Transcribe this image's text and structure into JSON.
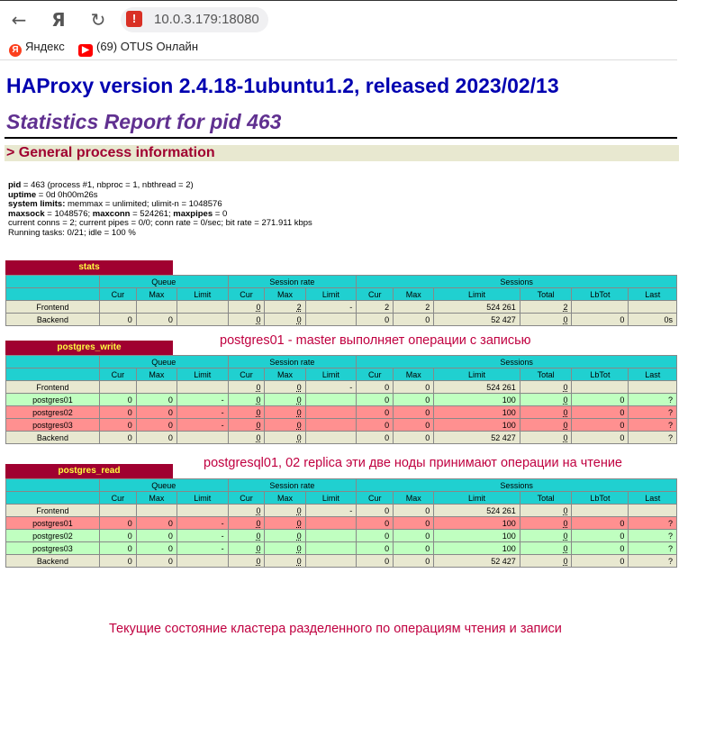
{
  "browser": {
    "url": "10.0.3.179:18080",
    "bookmarks": [
      "Яндекс",
      "(69) OTUS Онлайн"
    ]
  },
  "page": {
    "title": "HAProxy version 2.4.18-1ubuntu1.2, released 2023/02/13",
    "subtitle": "Statistics Report for pid 463",
    "section": "> General process information"
  },
  "info": {
    "pid_label": "pid",
    "pid_value": " = 463 (process #1, nbproc = 1, nbthread = 2)",
    "uptime_label": "uptime",
    "uptime_value": " = 0d 0h00m26s",
    "limits_label": "system limits:",
    "limits_value": " memmax = unlimited; ulimit-n = 1048576",
    "maxsock_label": "maxsock",
    "maxsock_value": " = 1048576; ",
    "maxconn_label": "maxconn",
    "maxconn_value": " = 524261; ",
    "maxpipes_label": "maxpipes",
    "maxpipes_value": " = 0",
    "conns_line": "current conns = 2; current pipes = 0/0; conn rate = 0/sec; bit rate = 271.911 kbps",
    "tasks_line": "Running tasks: 0/21; idle = 100 %"
  },
  "headers": {
    "queue": "Queue",
    "session_rate": "Session rate",
    "sessions": "Sessions",
    "cur": "Cur",
    "max": "Max",
    "limit": "Limit",
    "total": "Total",
    "lbtot": "LbTot",
    "last": "Last"
  },
  "stats": {
    "name": "stats",
    "rows": [
      {
        "name": "Frontend",
        "q_cur": "",
        "q_max": "",
        "q_lim": "",
        "r_cur": "0",
        "r_max": "2",
        "r_lim": "-",
        "s_cur": "2",
        "s_max": "2",
        "s_lim": "524 261",
        "s_tot": "2",
        "lbtot": "",
        "last": ""
      },
      {
        "name": "Backend",
        "q_cur": "0",
        "q_max": "0",
        "q_lim": "",
        "r_cur": "0",
        "r_max": "0",
        "r_lim": "",
        "s_cur": "0",
        "s_max": "0",
        "s_lim": "52 427",
        "s_tot": "0",
        "lbtot": "0",
        "last": "0s"
      }
    ]
  },
  "postgres_write": {
    "name": "postgres_write",
    "rows": [
      {
        "name": "Frontend",
        "q_cur": "",
        "q_max": "",
        "q_lim": "",
        "r_cur": "0",
        "r_max": "0",
        "r_lim": "-",
        "s_cur": "0",
        "s_max": "0",
        "s_lim": "524 261",
        "s_tot": "0",
        "lbtot": "",
        "last": ""
      },
      {
        "name": "postgres01",
        "q_cur": "0",
        "q_max": "0",
        "q_lim": "-",
        "r_cur": "0",
        "r_max": "0",
        "r_lim": "",
        "s_cur": "0",
        "s_max": "0",
        "s_lim": "100",
        "s_tot": "0",
        "lbtot": "0",
        "last": "?"
      },
      {
        "name": "postgres02",
        "q_cur": "0",
        "q_max": "0",
        "q_lim": "-",
        "r_cur": "0",
        "r_max": "0",
        "r_lim": "",
        "s_cur": "0",
        "s_max": "0",
        "s_lim": "100",
        "s_tot": "0",
        "lbtot": "0",
        "last": "?"
      },
      {
        "name": "postgres03",
        "q_cur": "0",
        "q_max": "0",
        "q_lim": "-",
        "r_cur": "0",
        "r_max": "0",
        "r_lim": "",
        "s_cur": "0",
        "s_max": "0",
        "s_lim": "100",
        "s_tot": "0",
        "lbtot": "0",
        "last": "?"
      },
      {
        "name": "Backend",
        "q_cur": "0",
        "q_max": "0",
        "q_lim": "",
        "r_cur": "0",
        "r_max": "0",
        "r_lim": "",
        "s_cur": "0",
        "s_max": "0",
        "s_lim": "52 427",
        "s_tot": "0",
        "lbtot": "0",
        "last": "?"
      }
    ]
  },
  "postgres_read": {
    "name": "postgres_read",
    "rows": [
      {
        "name": "Frontend",
        "q_cur": "",
        "q_max": "",
        "q_lim": "",
        "r_cur": "0",
        "r_max": "0",
        "r_lim": "-",
        "s_cur": "0",
        "s_max": "0",
        "s_lim": "524 261",
        "s_tot": "0",
        "lbtot": "",
        "last": ""
      },
      {
        "name": "postgres01",
        "q_cur": "0",
        "q_max": "0",
        "q_lim": "-",
        "r_cur": "0",
        "r_max": "0",
        "r_lim": "",
        "s_cur": "0",
        "s_max": "0",
        "s_lim": "100",
        "s_tot": "0",
        "lbtot": "0",
        "last": "?"
      },
      {
        "name": "postgres02",
        "q_cur": "0",
        "q_max": "0",
        "q_lim": "-",
        "r_cur": "0",
        "r_max": "0",
        "r_lim": "",
        "s_cur": "0",
        "s_max": "0",
        "s_lim": "100",
        "s_tot": "0",
        "lbtot": "0",
        "last": "?"
      },
      {
        "name": "postgres03",
        "q_cur": "0",
        "q_max": "0",
        "q_lim": "-",
        "r_cur": "0",
        "r_max": "0",
        "r_lim": "",
        "s_cur": "0",
        "s_max": "0",
        "s_lim": "100",
        "s_tot": "0",
        "lbtot": "0",
        "last": "?"
      },
      {
        "name": "Backend",
        "q_cur": "0",
        "q_max": "0",
        "q_lim": "",
        "r_cur": "0",
        "r_max": "0",
        "r_lim": "",
        "s_cur": "0",
        "s_max": "0",
        "s_lim": "52 427",
        "s_tot": "0",
        "lbtot": "0",
        "last": "?"
      }
    ]
  },
  "notes": {
    "write_note": "postgres01 - master выполняет операции с записью",
    "read_note": "postgresql01, 02 replica эти две ноды принимают операции на чтение",
    "bottom_note": "Текущие состояние кластера разделенного по  операциям чтения и записи"
  },
  "colors": {
    "up": "#c0ffc0",
    "down": "#ff9090",
    "header": "#20d0d0",
    "proxy_title_bg": "#a00030"
  }
}
